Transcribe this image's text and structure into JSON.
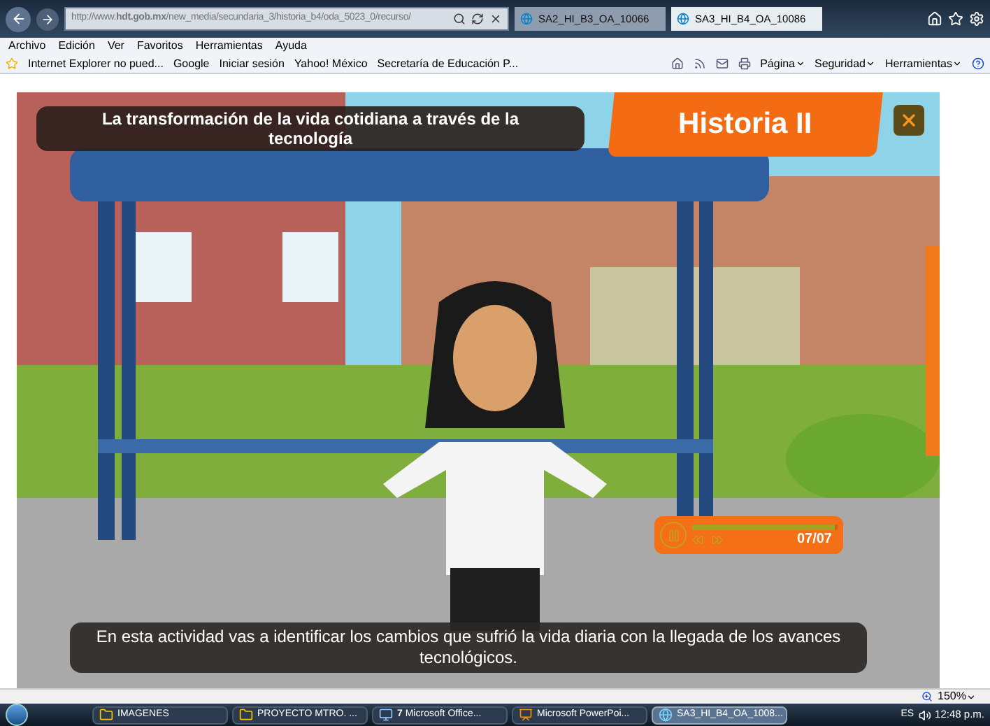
{
  "address_bar": {
    "url": "http://www.**hdt.gob.mx**/new_media/secundaria_3/historia_b4/oda_5023_0/recurso/"
  },
  "tabs": [
    {
      "label": "SA2_HI_B3_OA_10066",
      "selected": false
    },
    {
      "label": "SA3_HI_B4_OA_10086",
      "selected": true
    }
  ],
  "menu": [
    "Archivo",
    "Edición",
    "Ver",
    "Favoritos",
    "Herramientas",
    "Ayuda"
  ],
  "favorites": [
    "Internet Explorer no pued...",
    "Google",
    "Iniciar sesión",
    "Yahoo! México",
    "Secretaría de Educación P..."
  ],
  "command_bar": [
    "Página",
    "Seguridad",
    "Herramientas"
  ],
  "activity": {
    "title": "La transformación de la vida cotidiana a través de la tecnología",
    "subject": "Historia II",
    "subtitle": "En esta actividad vas a identificar los cambios que sufrió la vida diaria con la llegada de los avances tecnológicos.",
    "player": {
      "playing": true,
      "level": 0.98,
      "counter": "07/07"
    }
  },
  "status_bar": {
    "zoom": "150%"
  },
  "taskbar": {
    "items": [
      {
        "label": "IMAGENES",
        "kind": "folder",
        "selected": false
      },
      {
        "label": "PROYECTO MTRO. ...",
        "kind": "folder",
        "selected": false
      },
      {
        "label": "**7** Microsoft Office...",
        "kind": "group",
        "selected": false
      },
      {
        "label": "Microsoft PowerPoi...",
        "kind": "powerpoint",
        "selected": false
      },
      {
        "label": "SA3_HI_B4_OA_1008...",
        "kind": "browser",
        "selected": true
      }
    ],
    "language": "ES",
    "clock": "12:48 p.m."
  }
}
